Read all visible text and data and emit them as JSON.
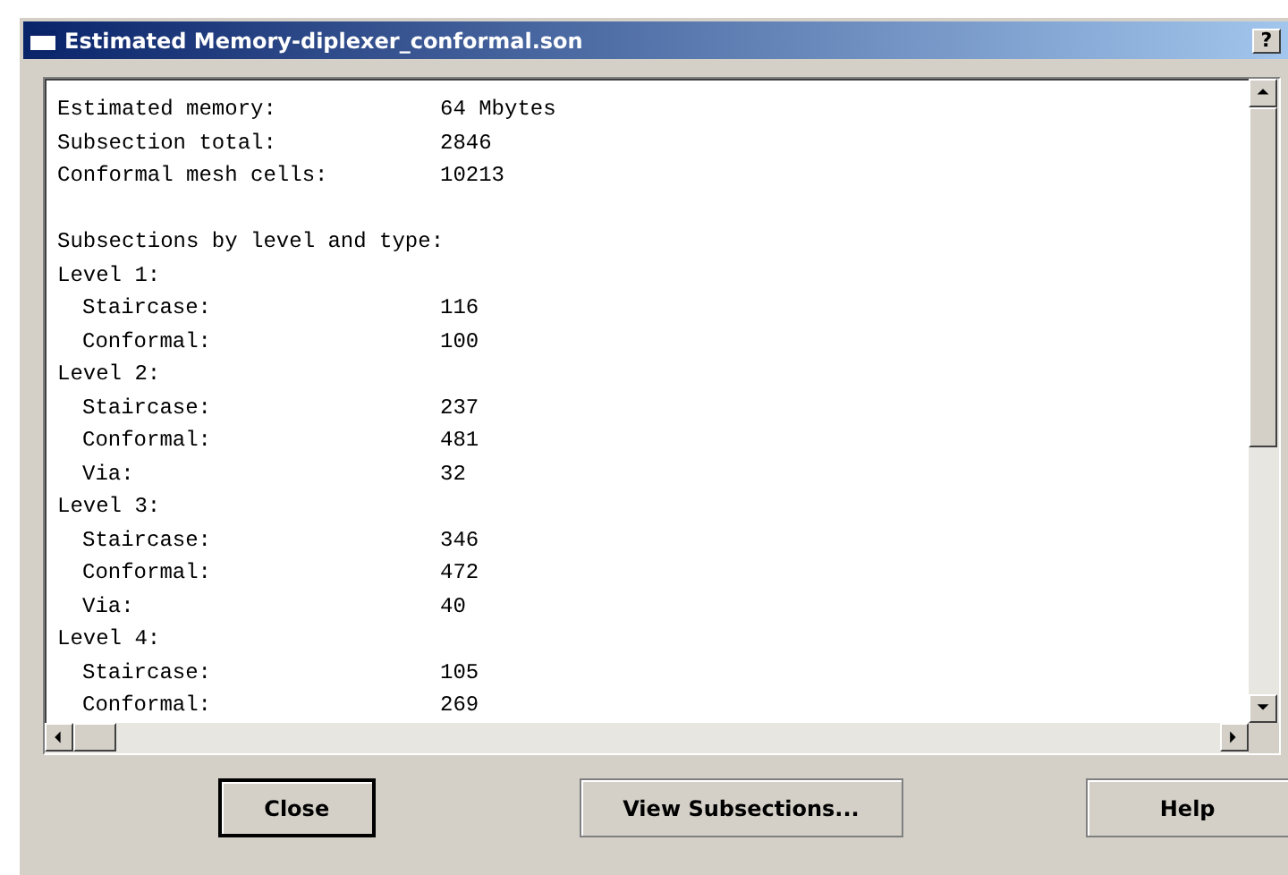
{
  "window": {
    "title": "Estimated Memory-diplexer_conformal.son",
    "help_glyph": "?"
  },
  "report": {
    "summary": [
      {
        "label": "Estimated memory:",
        "value": "64 Mbytes"
      },
      {
        "label": "Subsection total:",
        "value": "2846"
      },
      {
        "label": "Conformal mesh cells:",
        "value": "10213"
      }
    ],
    "heading": "Subsections by level and type:",
    "levels": [
      {
        "label": "Level 1:",
        "children": [
          {
            "label": "Staircase:",
            "value": "116"
          },
          {
            "label": "Conformal:",
            "value": "100"
          }
        ]
      },
      {
        "label": "Level 2:",
        "children": [
          {
            "label": "Staircase:",
            "value": "237"
          },
          {
            "label": "Conformal:",
            "value": "481"
          },
          {
            "label": "Via:",
            "value": "32"
          }
        ]
      },
      {
        "label": "Level 3:",
        "children": [
          {
            "label": "Staircase:",
            "value": "346"
          },
          {
            "label": "Conformal:",
            "value": "472"
          },
          {
            "label": "Via:",
            "value": "40"
          }
        ]
      },
      {
        "label": "Level 4:",
        "children": [
          {
            "label": "Staircase:",
            "value": "105"
          },
          {
            "label": "Conformal:",
            "value": "269"
          }
        ]
      }
    ]
  },
  "buttons": [
    {
      "label": "Close",
      "selected": true
    },
    {
      "label": "View Subsections...",
      "selected": false
    },
    {
      "label": "Help",
      "selected": false
    }
  ]
}
